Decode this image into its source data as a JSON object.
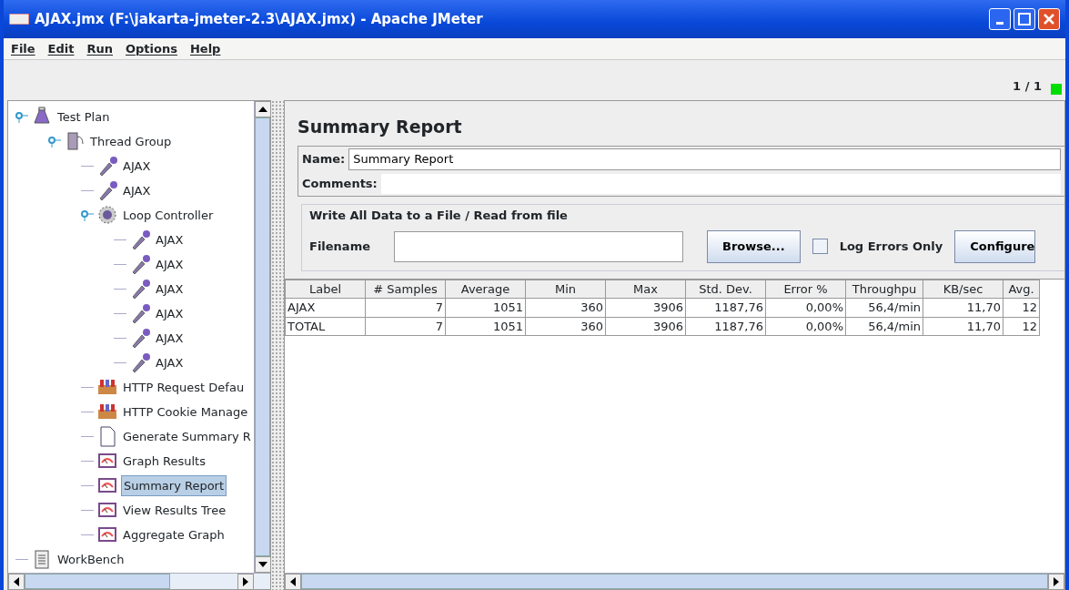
{
  "window": {
    "title": "AJAX.jmx (F:\\jakarta-jmeter-2.3\\AJAX.jmx) - Apache JMeter"
  },
  "menu": [
    "File",
    "Edit",
    "Run",
    "Options",
    "Help"
  ],
  "status": {
    "threads": "1 / 1",
    "running": true
  },
  "tree": [
    {
      "label": "Test Plan",
      "kind": "plan",
      "expanded": true,
      "selected": false,
      "children": [
        {
          "label": "Thread Group",
          "kind": "thread",
          "expanded": true,
          "selected": false,
          "children": [
            {
              "label": "AJAX",
              "kind": "sampler",
              "selected": false
            },
            {
              "label": "AJAX",
              "kind": "sampler",
              "selected": false
            },
            {
              "label": "Loop Controller",
              "kind": "loop",
              "expanded": true,
              "selected": false,
              "children": [
                {
                  "label": "AJAX",
                  "kind": "sampler",
                  "selected": false
                },
                {
                  "label": "AJAX",
                  "kind": "sampler",
                  "selected": false
                },
                {
                  "label": "AJAX",
                  "kind": "sampler",
                  "selected": false
                },
                {
                  "label": "AJAX",
                  "kind": "sampler",
                  "selected": false
                },
                {
                  "label": "AJAX",
                  "kind": "sampler",
                  "selected": false
                },
                {
                  "label": "AJAX",
                  "kind": "sampler",
                  "selected": false
                }
              ]
            },
            {
              "label": "HTTP Request Defau",
              "kind": "config",
              "selected": false
            },
            {
              "label": "HTTP Cookie Manage",
              "kind": "config",
              "selected": false
            },
            {
              "label": "Generate Summary R",
              "kind": "doc",
              "selected": false
            },
            {
              "label": "Graph Results",
              "kind": "listener",
              "selected": false
            },
            {
              "label": "Summary Report",
              "kind": "listener",
              "selected": true
            },
            {
              "label": "View Results Tree",
              "kind": "listener",
              "selected": false
            },
            {
              "label": "Aggregate Graph",
              "kind": "listener",
              "selected": false
            }
          ]
        }
      ]
    },
    {
      "label": "WorkBench",
      "kind": "bench",
      "selected": false
    }
  ],
  "panel": {
    "title": "Summary Report",
    "name_label": "Name:",
    "name_value": "Summary Report",
    "comments_label": "Comments:",
    "file_group": "Write All Data to a File / Read from file",
    "filename_label": "Filename",
    "browse": "Browse...",
    "log_errors": {
      "label": "Log Errors Only",
      "checked": false
    },
    "configure": "Configure"
  },
  "table": {
    "columns": [
      "Label",
      "# Samples",
      "Average",
      "Min",
      "Max",
      "Std. Dev.",
      "Error %",
      "Throughpu",
      "KB/sec",
      "Avg."
    ],
    "rows": [
      [
        "AJAX",
        "7",
        "1051",
        "360",
        "3906",
        "1187,76",
        "0,00%",
        "56,4/min",
        "11,70",
        "12"
      ],
      [
        "TOTAL",
        "7",
        "1051",
        "360",
        "3906",
        "1187,76",
        "0,00%",
        "56,4/min",
        "11,70",
        "12"
      ]
    ]
  }
}
